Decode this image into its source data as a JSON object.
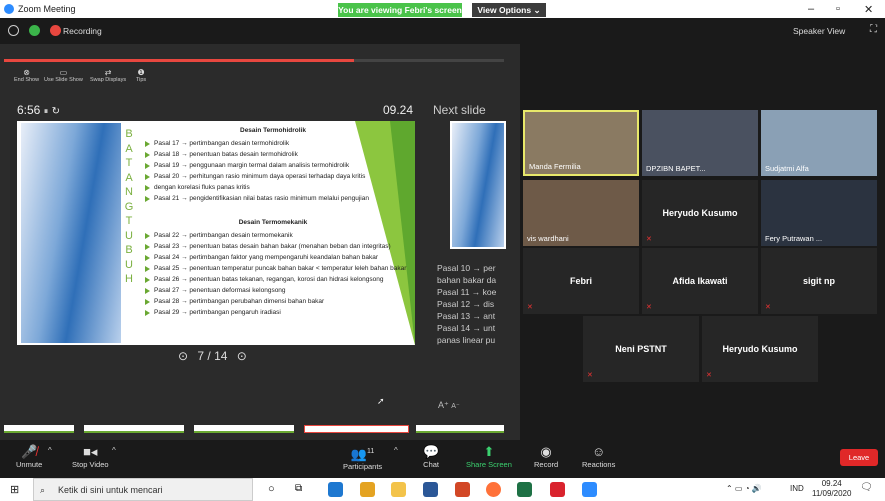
{
  "window": {
    "title": "Zoom Meeting",
    "viewing": "You are viewing Febri's screen",
    "view_options": "View Options ⌄"
  },
  "topbar": {
    "recording": "Recording",
    "speaker_view": "Speaker View"
  },
  "slide_tools": [
    {
      "icon": "⊗",
      "label": "End Show"
    },
    {
      "icon": "▭",
      "label": "Use Slide Show"
    },
    {
      "icon": "⇄",
      "label": "Swap Displays"
    },
    {
      "icon": "❶",
      "label": "Tips"
    }
  ],
  "progress": 0.7,
  "presenter": {
    "timer": "6:56",
    "clock": "09.24",
    "next_label": "Next slide",
    "nav": "7 / 14",
    "font_inc": "A⁺",
    "font_dec": "A⁻"
  },
  "slide": {
    "vertical_word": [
      "B",
      "A",
      "T",
      "A",
      "N",
      "G",
      "",
      "T",
      "U",
      "B",
      "U",
      "H"
    ],
    "heading1": "Desain Termohidrolik",
    "items1": [
      "Pasal 17 → pertimbangan desain termohidrolik",
      "Pasal 18 → penentuan batas desain termohidrolik",
      "Pasal 19 → penggunaan margin termal dalam analisis termohidrolik",
      "Pasal 20 → perhitungan rasio minimum daya operasi terhadap daya kritis",
      "dengan korelasi fluks panas kritis",
      "Pasal 21 → pengidentifikasian nilai batas rasio minimum melalui pengujian"
    ],
    "heading2": "Desain Termomekanik",
    "items2": [
      "Pasal 22 → pertimbangan desain termomekanik",
      "Pasal 23 → penentuan batas desain bahan bakar (menahan beban dan integritas)",
      "Pasal 24 → pertimbangan faktor yang mempengaruhi keandalan bahan bakar",
      "Pasal 25 → penentuan temperatur puncak bahan bakar < temperatur leleh bahan bakar",
      "Pasal 26 → penentuan batas tekanan, regangan, korosi dan hidrasi kelongsong",
      "Pasal 27 → penentuan deformasi kelongsong",
      "Pasal 28 → pertimbangan perubahan dimensi bahan bakar",
      "Pasal 29 → pertimbangan pengaruh iradiasi"
    ]
  },
  "notes": [
    "Pasal 10 → per",
    "bahan bakar da",
    "Pasal 11 → koe",
    "Pasal 12 → dis",
    "Pasal 13 → ant",
    "Pasal 14 → unt",
    "panas linear pu"
  ],
  "participants": [
    {
      "name": "Manda Fermilia",
      "video": true,
      "active": true
    },
    {
      "name": "DPZIBN BAPET...",
      "video": true,
      "active": false
    },
    {
      "name": "Sudjatmi Alfa",
      "video": true,
      "active": false
    },
    {
      "name": "vis wardhani",
      "video": true,
      "active": false
    },
    {
      "name": "Heryudo Kusumo",
      "video": false,
      "active": false
    },
    {
      "name": "Fery Putrawan ...",
      "video": true,
      "active": false
    },
    {
      "name": "Febri",
      "video": false,
      "active": false
    },
    {
      "name": "Afida Ikawati",
      "video": false,
      "active": false
    },
    {
      "name": "sigit np",
      "video": false,
      "active": false
    },
    {
      "name": "Neni PSTNT",
      "video": false,
      "active": false
    },
    {
      "name": "Heryudo Kusumo",
      "video": false,
      "active": false
    }
  ],
  "toolbar": {
    "unmute": "Unmute",
    "stop_video": "Stop Video",
    "participants": "Participants",
    "participant_count": "11",
    "chat": "Chat",
    "share": "Share Screen",
    "record": "Record",
    "reactions": "Reactions",
    "leave": "Leave"
  },
  "taskbar": {
    "search": "Ketik di sini untuk mencari",
    "lang": "IND",
    "time": "09.24",
    "date": "11/09/2020"
  }
}
